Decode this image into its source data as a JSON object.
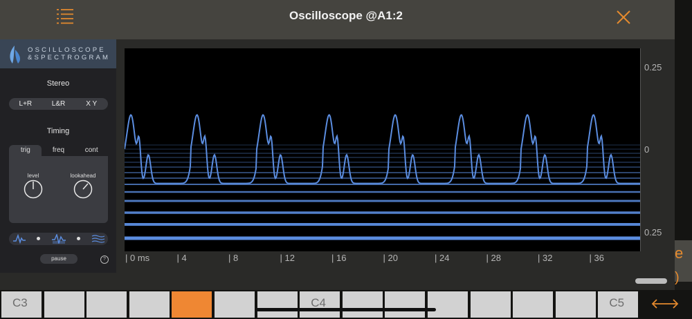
{
  "header": {
    "title": "Oscilloscope @A1:2"
  },
  "brand": {
    "line1": "OSCILLOSCOPE",
    "line2": "&SPECTROGRAM"
  },
  "stereo": {
    "label": "Stereo",
    "options": [
      "L+R",
      "L&R",
      "X Y"
    ]
  },
  "timing": {
    "label": "Timing",
    "tabs": [
      "trig",
      "freq",
      "cont"
    ],
    "level_label": "level",
    "lookahead_label": "lookahead"
  },
  "controls": {
    "pause_label": "pause",
    "help_label": "?"
  },
  "scope": {
    "y_ticks": [
      "0.25",
      "0",
      "0.25"
    ],
    "x_ticks": [
      "0 ms",
      "4",
      "8",
      "12",
      "16",
      "20",
      "24",
      "28",
      "32",
      "36"
    ]
  },
  "keyboard": {
    "keys": [
      "C3",
      "",
      "",
      "",
      "",
      "",
      "",
      "C4",
      "",
      "",
      "",
      "",
      "",
      "",
      "C5"
    ],
    "active_index": 4
  },
  "colors": {
    "accent": "#ef8733",
    "waveform": "#5b8de0",
    "header_bg": "#45443f"
  }
}
